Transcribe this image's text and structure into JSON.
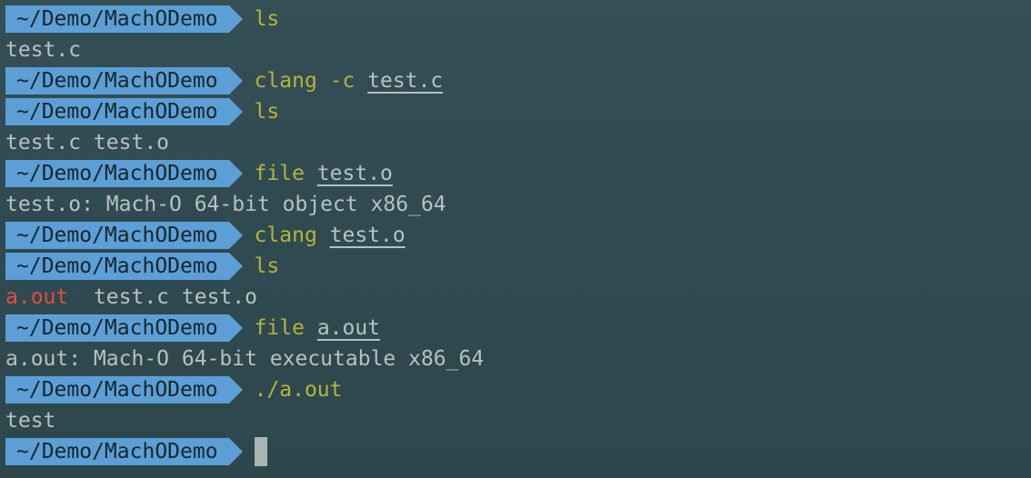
{
  "window": {
    "background": "#30494f",
    "prompt_color": "#5c9fd6",
    "command_color": "#b5b43a",
    "output_color": "#b8c1c1",
    "red_output_color": "#e0503e"
  },
  "prompt": {
    "path": "~/Demo/MachODemo"
  },
  "lines": [
    {
      "type": "prompt",
      "cmd": "ls",
      "arg": ""
    },
    {
      "type": "output",
      "text": "test.c"
    },
    {
      "type": "prompt",
      "cmd": "clang -c ",
      "arg": "test.c"
    },
    {
      "type": "prompt",
      "cmd": "ls",
      "arg": ""
    },
    {
      "type": "output",
      "text": "test.c test.o"
    },
    {
      "type": "prompt",
      "cmd": "file ",
      "arg": "test.o"
    },
    {
      "type": "output",
      "text": "test.o: Mach-O 64-bit object x86_64"
    },
    {
      "type": "prompt",
      "cmd": "clang ",
      "arg": "test.o"
    },
    {
      "type": "prompt",
      "cmd": "ls",
      "arg": ""
    },
    {
      "type": "output_colored",
      "text_red": "a.out",
      "text": "  test.c test.o"
    },
    {
      "type": "prompt",
      "cmd": "file ",
      "arg": "a.out"
    },
    {
      "type": "output",
      "text": "a.out: Mach-O 64-bit executable x86_64"
    },
    {
      "type": "prompt",
      "cmd": "./a.out",
      "arg": ""
    },
    {
      "type": "output",
      "text": "test"
    },
    {
      "type": "prompt_cursor"
    }
  ]
}
